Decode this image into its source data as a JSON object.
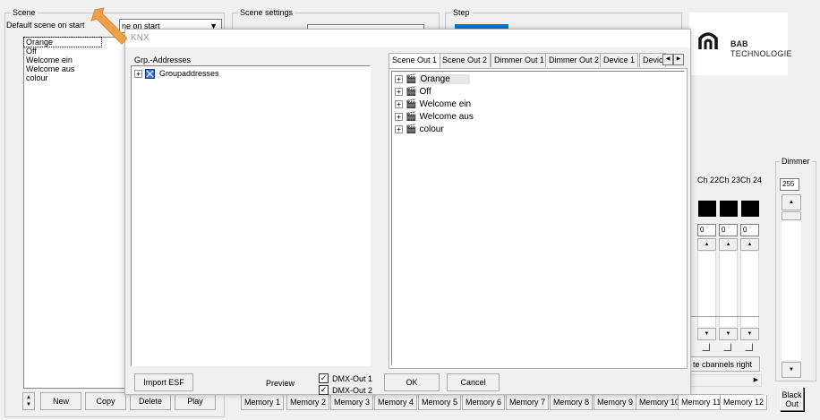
{
  "scene_panel": {
    "title": "Scene",
    "default_label": "Default scene on start",
    "default_select_value": "ne on start",
    "items": [
      "Orange",
      "Off",
      "Welcome ein",
      "Welcome aus",
      "colour"
    ],
    "new_label": "New",
    "copy_label": "Copy",
    "delete_label": "Delete",
    "play_label": "Play"
  },
  "scene_settings": {
    "title": "Scene settings"
  },
  "step_panel": {
    "title": "Step"
  },
  "logo": {
    "brand_top": "BAB",
    "brand_bottom": "TECHNOLOGIE"
  },
  "channels": {
    "headers": [
      "Ch 22",
      "Ch 23",
      "Ch 24"
    ],
    "values": [
      "0",
      "0",
      "0"
    ],
    "update_right_label": "te cbannels right"
  },
  "dimmer": {
    "title": "Dimmer",
    "value": "255",
    "blackout_line1": "Black",
    "blackout_line2": "Out"
  },
  "memory_tabs": [
    "Memory 1",
    "Memory 2",
    "Memory 3",
    "Memory 4",
    "Memory 5",
    "Memory 6",
    "Memory 7",
    "Memory 8",
    "Memory 9",
    "Memory 10",
    "Memory 11",
    "Memory 12"
  ],
  "dialog": {
    "title": "KNX",
    "grp_label": "Grp.-Addresses",
    "groupaddresses_label": "Groupaddresses",
    "tabs": [
      "Scene Out 1",
      "Scene Out 2",
      "Dimmer Out 1",
      "Dimmer Out 2",
      "Device 1",
      "Devic"
    ],
    "scene_tree": [
      "Orange",
      "Off",
      "Welcome ein",
      "Welcome aus",
      "colour"
    ],
    "import_label": "Import ESF",
    "preview_label": "Preview",
    "dmx_out1_label": "DMX-Out 1",
    "dmx_out2_label": "DMX-Out 2",
    "ok_label": "OK",
    "cancel_label": "Cancel"
  },
  "colors": {
    "arrow": "#f0a049",
    "dialog_bg": "#f0f0f0",
    "step_selected": "#0078d7"
  }
}
